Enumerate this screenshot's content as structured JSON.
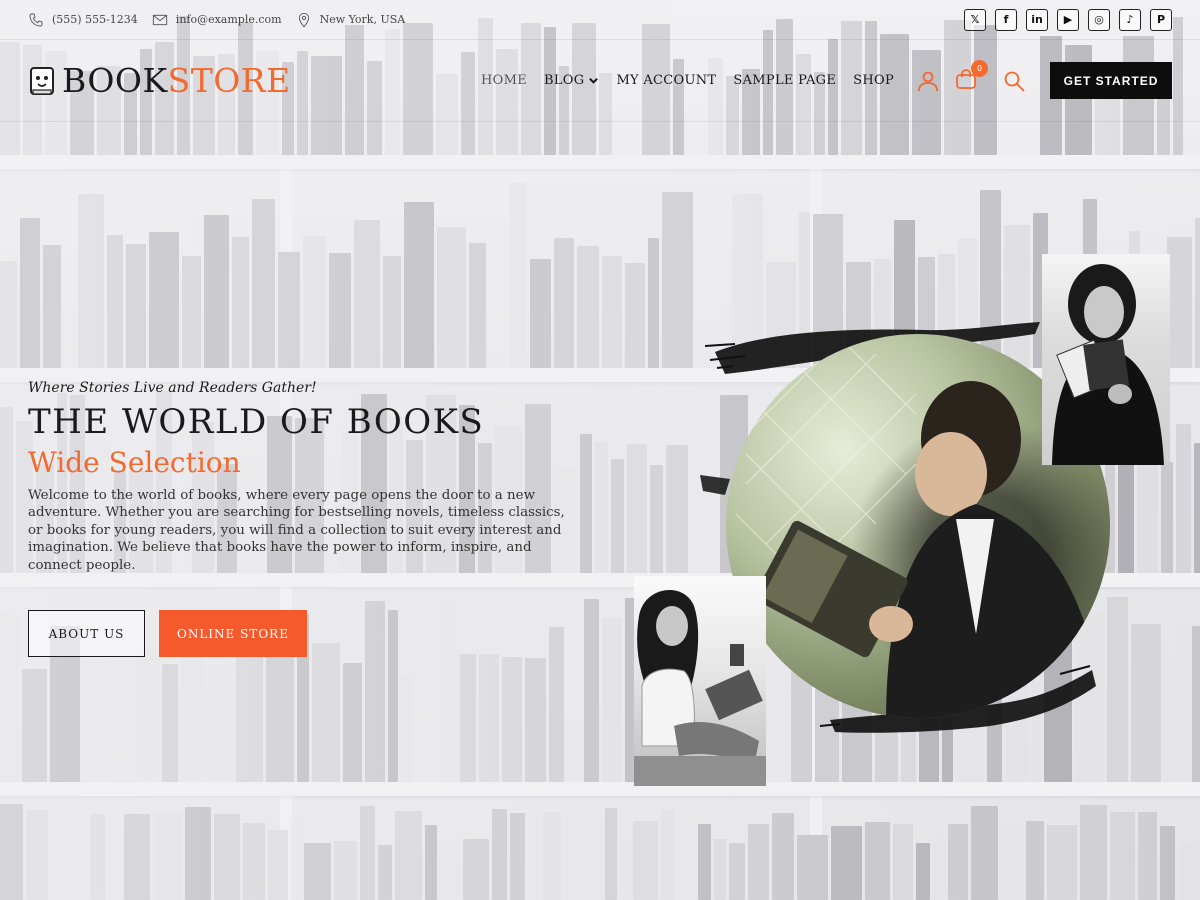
{
  "topbar": {
    "phone": "(555) 555-1234",
    "email": "info@example.com",
    "location": "New York, USA",
    "socials": [
      {
        "name": "x-icon",
        "glyph": "𝕏"
      },
      {
        "name": "facebook-icon",
        "glyph": "f"
      },
      {
        "name": "linkedin-icon",
        "glyph": "in"
      },
      {
        "name": "youtube-icon",
        "glyph": "▶"
      },
      {
        "name": "instagram-icon",
        "glyph": "◎"
      },
      {
        "name": "tiktok-icon",
        "glyph": "♪"
      },
      {
        "name": "pinterest-icon",
        "glyph": "P"
      }
    ]
  },
  "header": {
    "logo_part1": "BOOK",
    "logo_part2": "STORE",
    "nav": {
      "home": "HOME",
      "blog": "BLOG",
      "my_account": "MY ACCOUNT",
      "sample_page": "SAMPLE PAGE",
      "shop": "SHOP"
    },
    "cart_count": "0",
    "cta": "GET STARTED"
  },
  "hero": {
    "tagline": "Where Stories Live and Readers Gather!",
    "title": "THE WORLD OF BOOKS",
    "subtitle": "Wide Selection",
    "description": "Welcome to the world of books, where every page opens the door to a new adventure. Whether you are searching for bestselling novels, timeless classics, or books for young readers, you will find a collection to suit every interest and imagination. We believe that books have the power to inform, inspire, and connect people.",
    "button_about": "ABOUT US",
    "button_store": "ONLINE STORE"
  },
  "colors": {
    "accent": "#f26a2e",
    "button_orange": "#f55a2c",
    "dark": "#0d0d0d"
  }
}
